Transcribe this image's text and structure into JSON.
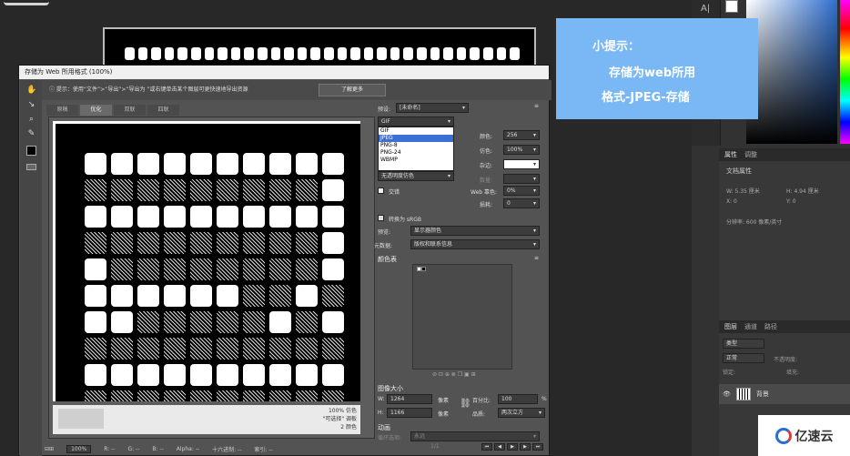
{
  "dialog": {
    "title": "存储为 Web 所用格式 (100%)",
    "hint": "提示：使用“文件”>“导出”>“导出为   ”或右键单击某个图层可更快速地导出资源",
    "learn_more": "了解更多",
    "tabs": [
      "原稿",
      "优化",
      "双联",
      "四联"
    ],
    "preview_info": [
      "100% 仿色",
      "\"可选择\" 调板",
      "2 颜色"
    ],
    "status": {
      "zoom": "100%",
      "r": "R: --",
      "g": "G: --",
      "b": "B: --",
      "alpha": "Alpha: --",
      "hex": "十六进制: --",
      "index": "索引: --"
    }
  },
  "settings": {
    "preset_label": "预设:",
    "preset_value": "[未命名]",
    "format_value": "GIF",
    "format_options": [
      "GIF",
      "JPEG",
      "PNG-8",
      "PNG-24",
      "WBMP"
    ],
    "format_selected": "JPEG",
    "colors_label": "颜色:",
    "colors_value": "256",
    "dither_label": "仿色:",
    "dither_value": "100%",
    "matte_label": "杂边:",
    "amount_label": "数量:",
    "transparency_dither": "无透明度仿色",
    "interlaced_label": "交错",
    "websnap_label": "Web 靠色:",
    "websnap_value": "0%",
    "lossy_label": "损耗:",
    "lossy_value": "0",
    "convert_srgb": "转换为 sRGB",
    "preview_label": "预览:",
    "preview_value": "显示器颜色",
    "metadata_label": "元数据:",
    "metadata_value": "版权和联系信息",
    "color_table_label": "颜色表",
    "image_size_label": "图像大小",
    "w_label": "W:",
    "w_value": "1264",
    "h_label": "H:",
    "h_value": "1166",
    "px_unit": "像素",
    "percent_label": "百分比:",
    "percent_value": "100",
    "percent_unit": "%",
    "quality_label": "品质:",
    "quality_value": "两次立方",
    "animation_label": "动画",
    "loop_label": "循环选项:",
    "loop_value": "永远",
    "frame_counter": "1/1"
  },
  "tip": {
    "line1": "小提示：",
    "line2": "存储为web所用",
    "line3": "格式-JPEG-存储"
  },
  "properties_panel": {
    "tabs": [
      "属性",
      "调整"
    ],
    "title": "文档属性",
    "w": "W: 5.35 厘米",
    "h": "H: 4.94 厘米",
    "x": "X: 0",
    "y": "Y: 0",
    "resolution": "分辨率: 600 像素/英寸"
  },
  "layers_panel": {
    "tabs": [
      "图层",
      "通道",
      "路径"
    ],
    "kind": "类型",
    "blend": "正常",
    "opacity": "不透明度:",
    "lock": "锁定:",
    "fill": "填充:",
    "layer_name": "背景"
  },
  "watermark": {
    "text": "亿速云"
  },
  "colors": {
    "tip_bg": "#79b8f4",
    "selection": "#3c6fd6",
    "dialog_bg": "#535353"
  }
}
